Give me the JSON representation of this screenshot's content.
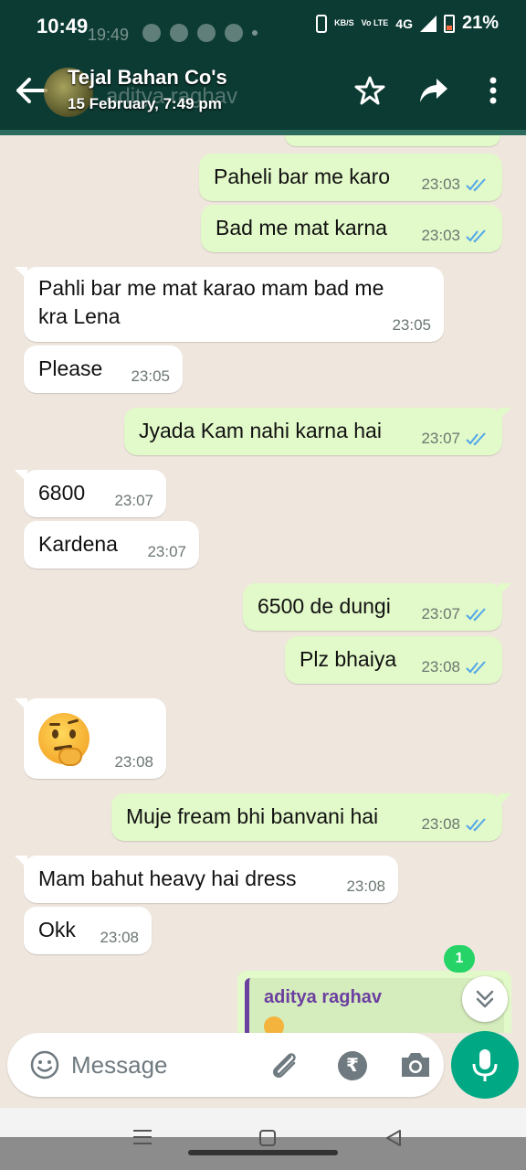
{
  "status_bar": {
    "time": "10:49",
    "ghost_time": "19:49",
    "net_speed": "KB/S",
    "volte": "Vo LTE",
    "network": "4G",
    "battery": "21%"
  },
  "header": {
    "title": "Tejal Bahan Co's",
    "subtitle": "15 February, 7:49 pm",
    "ghost_name": "aditya raghav",
    "colors": {
      "bar": "#0c3b33",
      "accent": "#00a884"
    }
  },
  "messages": [
    {
      "dir": "out",
      "text": "Paheli bar me karo",
      "time": "23:03",
      "read": true
    },
    {
      "dir": "out",
      "text": "Bad me mat karna",
      "time": "23:03",
      "read": true
    },
    {
      "dir": "in",
      "text": "Pahli bar me mat karao mam bad me",
      "text2": "kra Lena",
      "time": "23:05"
    },
    {
      "dir": "in",
      "text": "Please",
      "time": "23:05"
    },
    {
      "dir": "out",
      "text": "Jyada Kam nahi karna hai",
      "time": "23:07",
      "read": true
    },
    {
      "dir": "in",
      "text": "6800",
      "time": "23:07"
    },
    {
      "dir": "in",
      "text": "Kardena",
      "time": "23:07"
    },
    {
      "dir": "out",
      "text": "6500 de dungi",
      "time": "23:07",
      "read": true
    },
    {
      "dir": "out",
      "text": "Plz bhaiya",
      "time": "23:08",
      "read": true
    },
    {
      "dir": "in",
      "emoji": "thinking-face",
      "time": "23:08"
    },
    {
      "dir": "out",
      "text": "Muje fream bhi banvani hai",
      "time": "23:08",
      "read": true
    },
    {
      "dir": "in",
      "text": "Mam bahut heavy hai dress",
      "time": "23:08"
    },
    {
      "dir": "in",
      "text": "Okk",
      "time": "23:08"
    }
  ],
  "reply_preview": {
    "name": "aditya raghav",
    "emoji": "thinking-face"
  },
  "unread_count": "1",
  "composer": {
    "placeholder": "Message",
    "icons": [
      "emoji-icon",
      "attach-icon",
      "rupee-icon",
      "camera-icon",
      "mic-icon"
    ]
  },
  "nav": {
    "icons": [
      "menu-icon",
      "home-icon",
      "back-icon"
    ]
  }
}
